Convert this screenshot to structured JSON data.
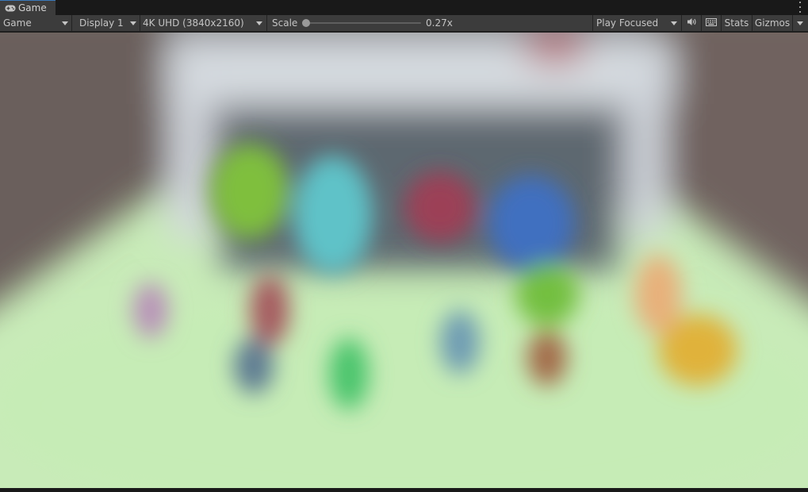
{
  "tab": {
    "label": "Game",
    "icon": "gamepad-icon"
  },
  "toolbar": {
    "view_mode": "Game",
    "display": "Display 1",
    "resolution": "4K UHD (3840x2160)",
    "scale_label": "Scale",
    "scale_value": "0.27x",
    "play_mode": "Play Focused",
    "audio_icon": "speaker-icon",
    "grid_icon": "keyboard-icon",
    "stats_label": "Stats",
    "gizmos_label": "Gizmos"
  },
  "colors": {
    "accent": "#3a79bb",
    "toolbar_bg": "#3c3c3c",
    "floor": "#c8ebb8",
    "walls": "#6b5e5b"
  }
}
